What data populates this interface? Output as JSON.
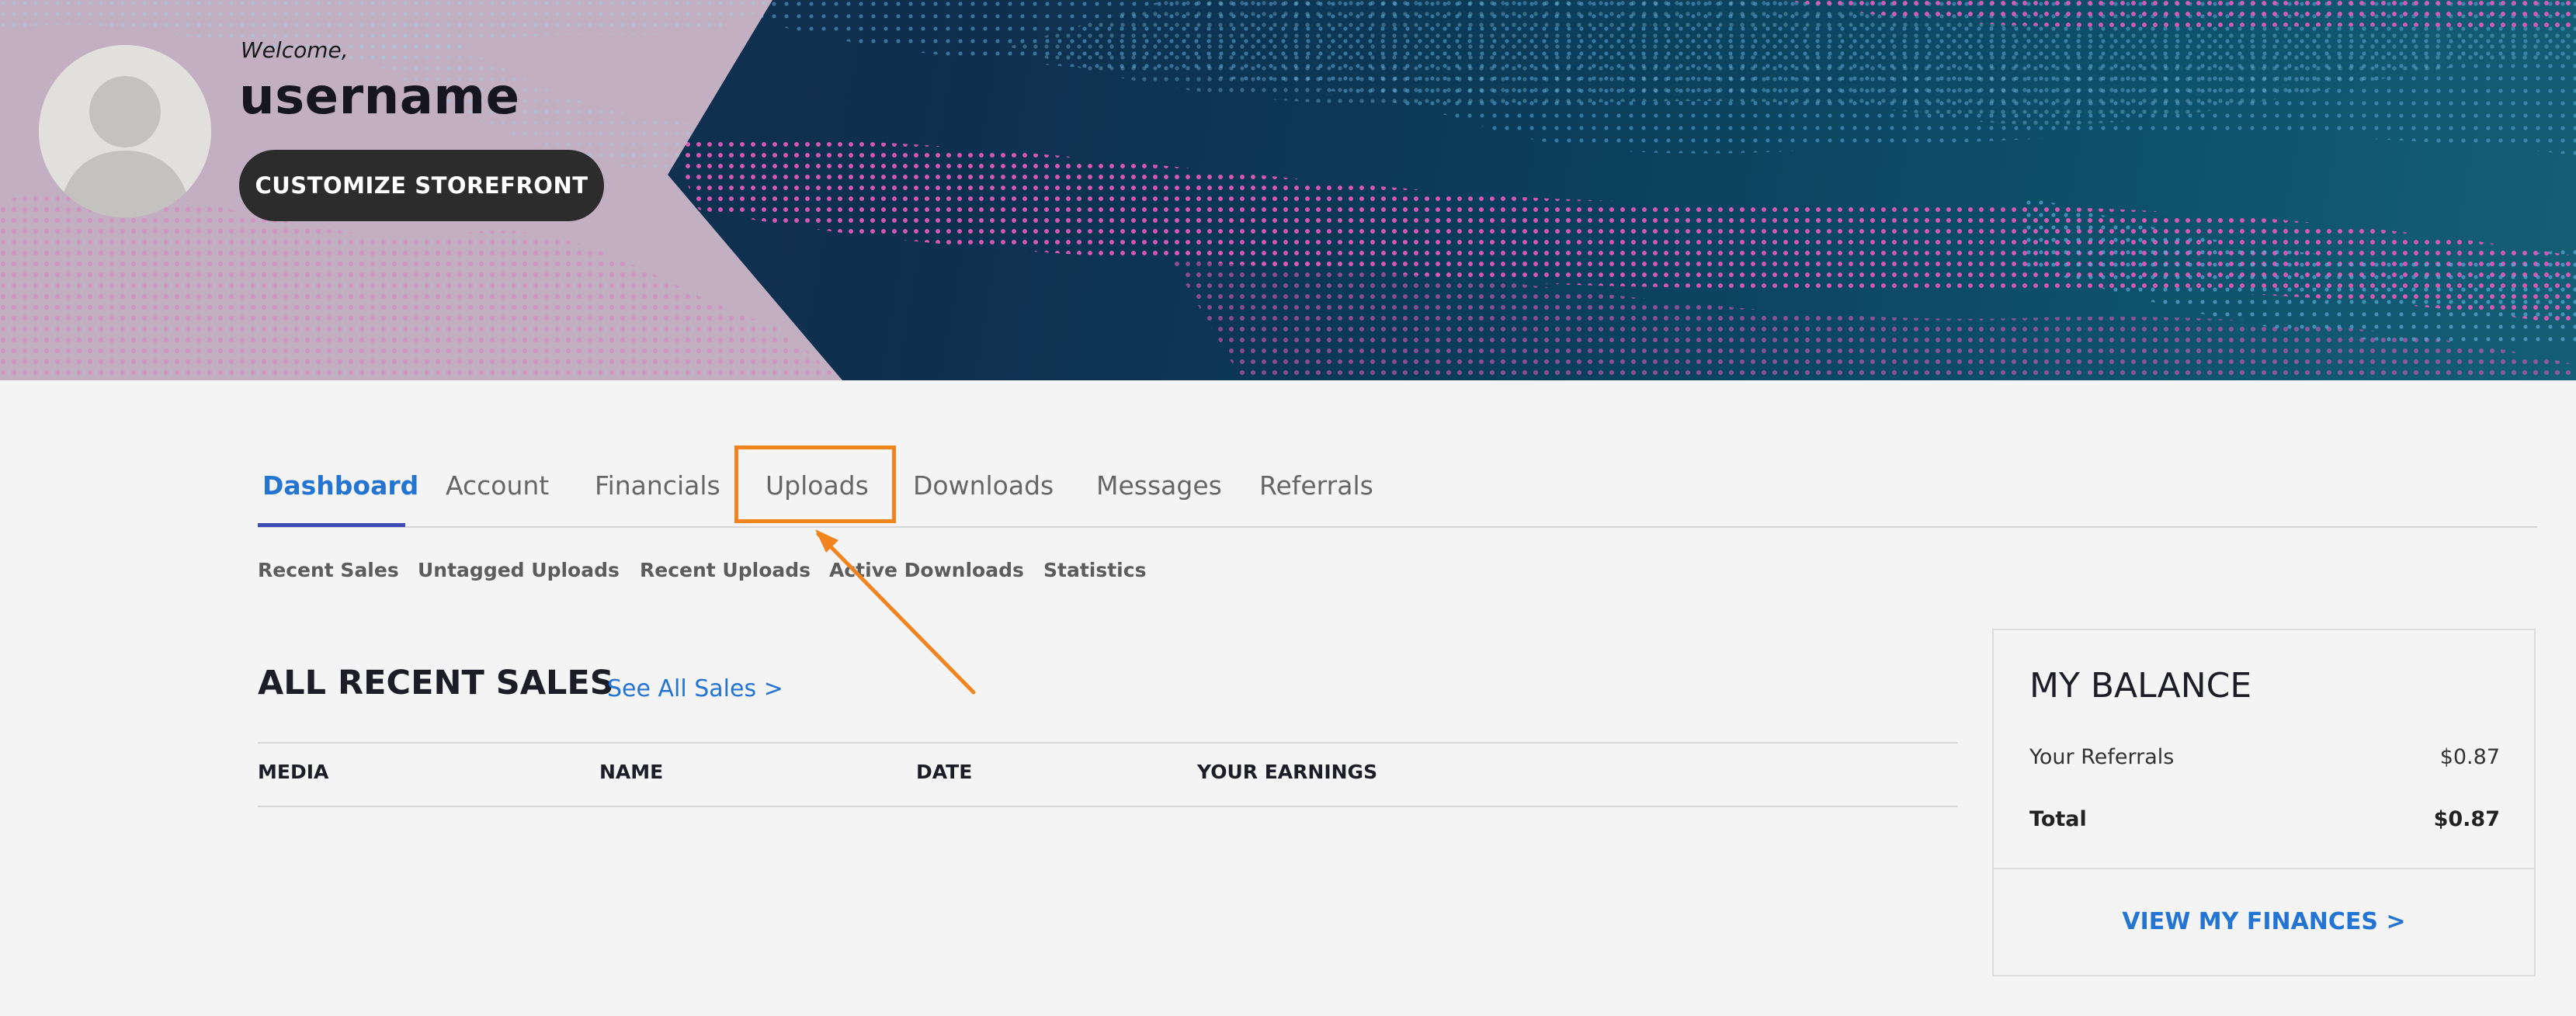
{
  "header": {
    "welcome": "Welcome,",
    "username": "username",
    "customize_label": "CUSTOMIZE STOREFRONT"
  },
  "tabs": [
    {
      "label": "Dashboard",
      "active": true
    },
    {
      "label": "Account",
      "active": false
    },
    {
      "label": "Financials",
      "active": false
    },
    {
      "label": "Uploads",
      "active": false,
      "highlighted": true
    },
    {
      "label": "Downloads",
      "active": false
    },
    {
      "label": "Messages",
      "active": false
    },
    {
      "label": "Referrals",
      "active": false
    }
  ],
  "subtabs": [
    {
      "label": "Recent Sales"
    },
    {
      "label": "Untagged Uploads"
    },
    {
      "label": "Recent Uploads"
    },
    {
      "label": "Active Downloads"
    },
    {
      "label": "Statistics"
    }
  ],
  "sales": {
    "title": "ALL RECENT SALES",
    "see_all": "See All Sales >",
    "columns": [
      "MEDIA",
      "NAME",
      "DATE",
      "YOUR EARNINGS"
    ],
    "rows": []
  },
  "balance": {
    "title": "MY BALANCE",
    "rows": [
      {
        "label": "Your Referrals",
        "value": "$0.87"
      },
      {
        "label": "Total",
        "value": "$0.87"
      }
    ],
    "view_label": "VIEW MY FINANCES >"
  },
  "colors": {
    "accent": "#2474d4",
    "annotation": "#f1841f",
    "tab_underline": "#3d4ab3",
    "button_bg": "#2c2c2c"
  },
  "icons": {
    "avatar": "default-user-silhouette-icon"
  }
}
